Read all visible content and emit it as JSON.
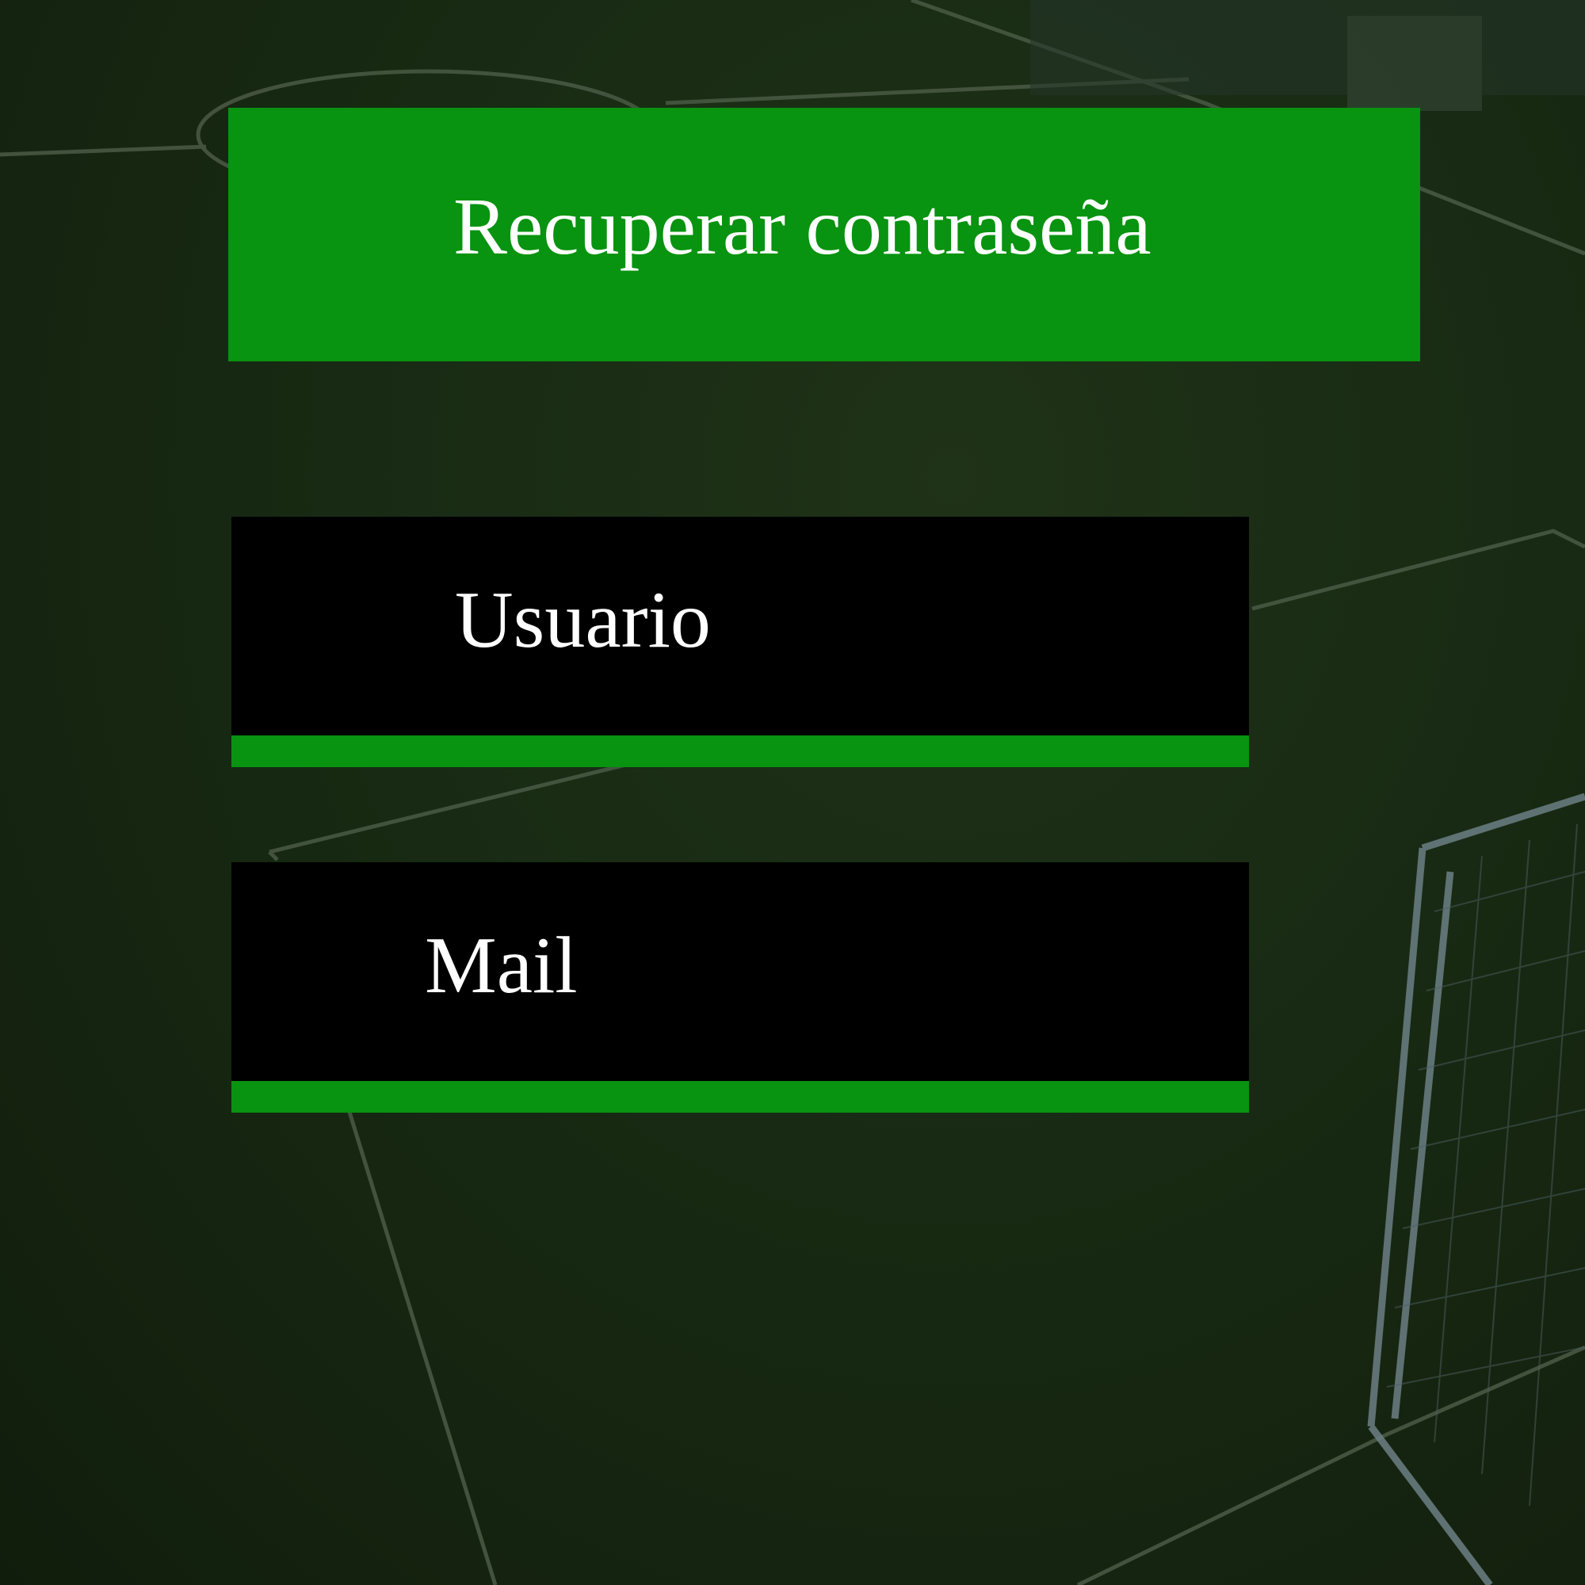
{
  "header": {
    "title": "Recuperar contraseña"
  },
  "form": {
    "usuario_placeholder": "Usuario",
    "mail_placeholder": "Mail"
  },
  "colors": {
    "accent_green": "#089310",
    "field_background": "#000000",
    "text": "#ffffff",
    "background_field_grass": "#182a13"
  }
}
